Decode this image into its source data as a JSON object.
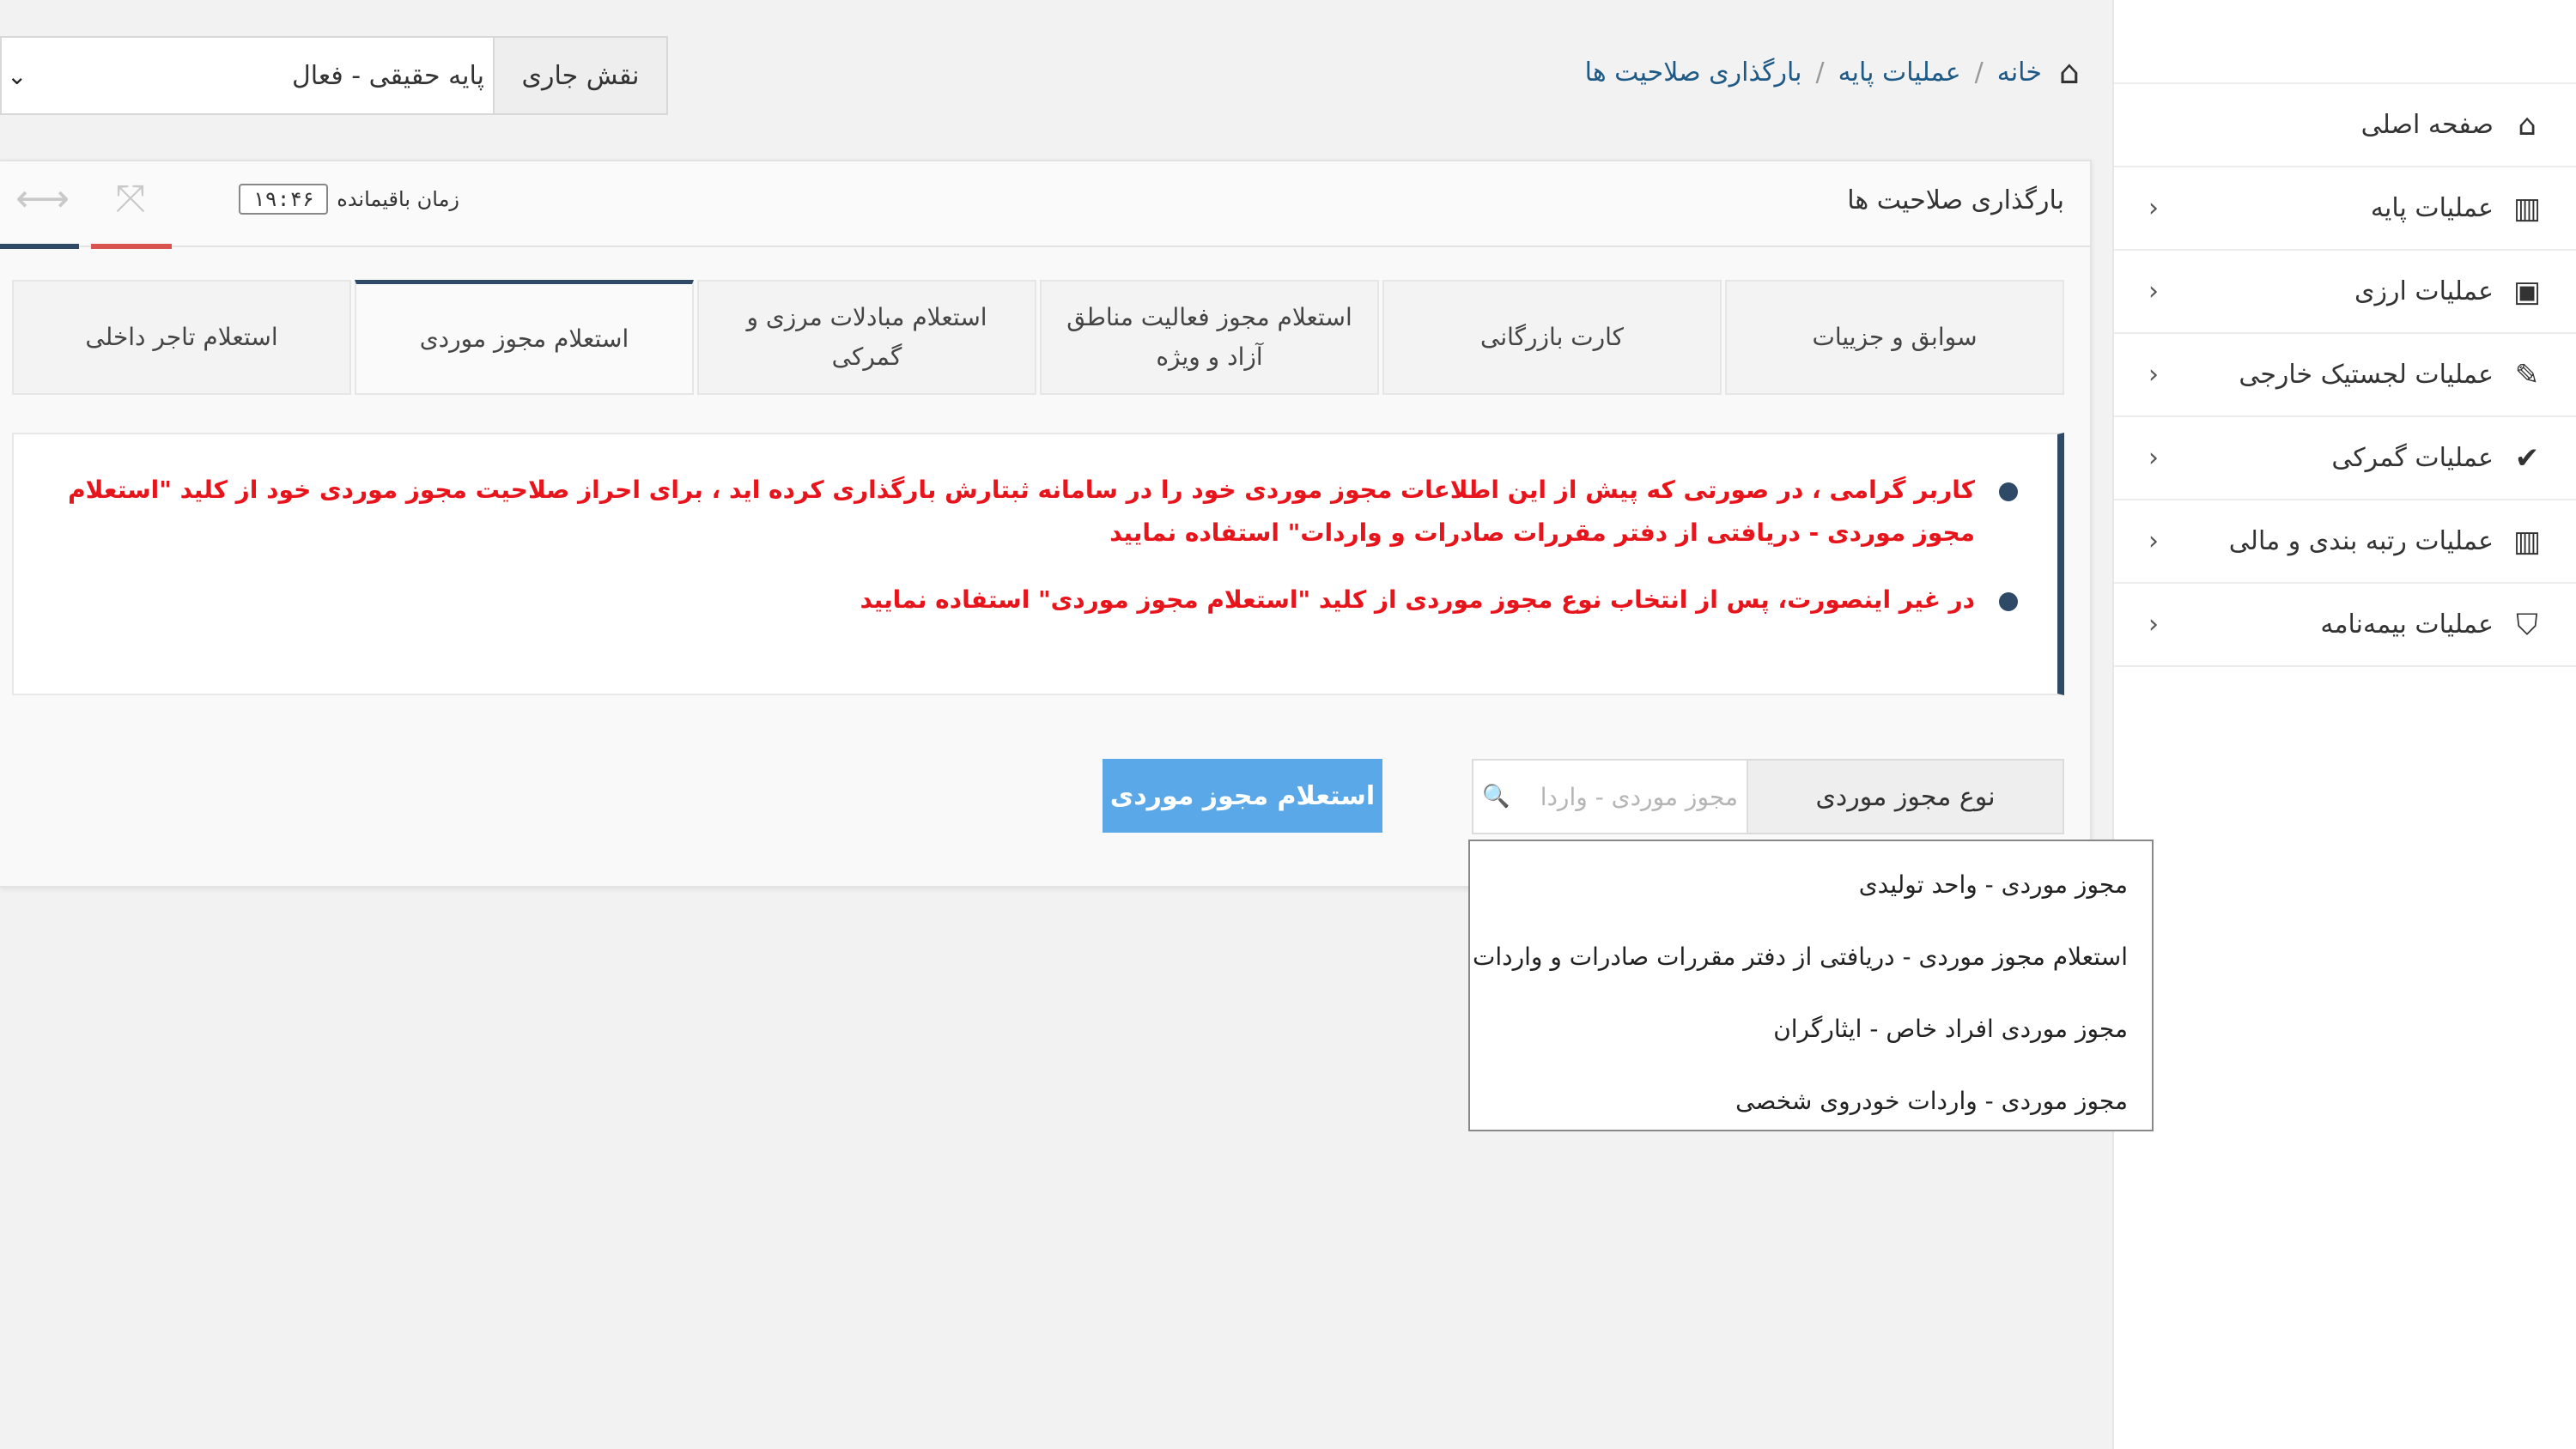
{
  "sidebar": {
    "items": [
      {
        "label": "صفحه اصلی",
        "icon": "home-icon",
        "glyph": "⌂",
        "chevron": ""
      },
      {
        "label": "عملیات پایه",
        "icon": "bar-chart-icon",
        "glyph": "▥",
        "chevron": "‹"
      },
      {
        "label": "عملیات ارزی",
        "icon": "money-icon",
        "glyph": "▣",
        "chevron": "‹"
      },
      {
        "label": "عملیات لجستیک خارجی",
        "icon": "edit-icon",
        "glyph": "✎",
        "chevron": "‹"
      },
      {
        "label": "عملیات گمرکی",
        "icon": "check-icon",
        "glyph": "✔",
        "chevron": "‹"
      },
      {
        "label": "عملیات رتبه بندی و مالی",
        "icon": "bar-chart-icon",
        "glyph": "▥",
        "chevron": "‹"
      },
      {
        "label": "عملیات بیمه‌نامه",
        "icon": "shield-icon",
        "glyph": "⛉",
        "chevron": "‹"
      }
    ]
  },
  "breadcrumb": {
    "home_glyph": "⌂",
    "items": [
      "خانه",
      "عملیات پایه",
      "بارگذاری صلاحیت ها"
    ],
    "separator": "/"
  },
  "role": {
    "label": "نقش جاری",
    "value": "پایه حقیقی - فعال",
    "chevron": "⌄"
  },
  "panel": {
    "title": "بارگذاری صلاحیت ها",
    "timer_label": "زمان باقیمانده",
    "timer_value": "۱۹:۴۶",
    "expand_glyph": "⤧",
    "resize_glyph": "⟷"
  },
  "tabs": [
    {
      "label": "سوابق و جزییات",
      "active": false
    },
    {
      "label": "کارت بازرگانی",
      "active": false
    },
    {
      "label": "استعلام مجوز فعالیت مناطق آزاد و ویژه",
      "active": false
    },
    {
      "label": "استعلام مبادلات مرزی و گمرکی",
      "active": false
    },
    {
      "label": "استعلام مجوز موردی",
      "active": true
    },
    {
      "label": "استعلام تاجر داخلی",
      "active": false
    }
  ],
  "notice": {
    "items": [
      "کاربر گرامی ، در صورتی که پیش از این اطلاعات مجوز موردی خود را در سامانه ثبتارش بارگذاری کرده اید ، برای احراز صلاحیت مجوز موردی خود از کلید \"استعلام مجوز موردی - دریافتی از دفتر مقررات صادرات و واردات\" استفاده نمایید",
      "در غیر اینصورت، پس از انتخاب نوع مجوز موردی از کلید \"استعلام مجوز موردی\" استفاده نمایید"
    ]
  },
  "form": {
    "field_label": "نوع مجوز موردی",
    "placeholder": "مجوز موردی - واردا",
    "search_glyph": "🔍",
    "button_label": "استعلام مجوز موردی"
  },
  "dropdown": {
    "options": [
      "مجوز موردی - واحد تولیدی",
      "استعلام مجوز موردی - دریافتی از دفتر مقررات صادرات و واردات",
      "مجوز موردی افراد خاص - ایثارگران",
      "مجوز موردی - واردات خودروی شخصی"
    ]
  },
  "colors": {
    "accent": "#2f4a66",
    "button": "#5aa8e8",
    "alert_text": "#e8141b",
    "link": "#1f5a86"
  }
}
